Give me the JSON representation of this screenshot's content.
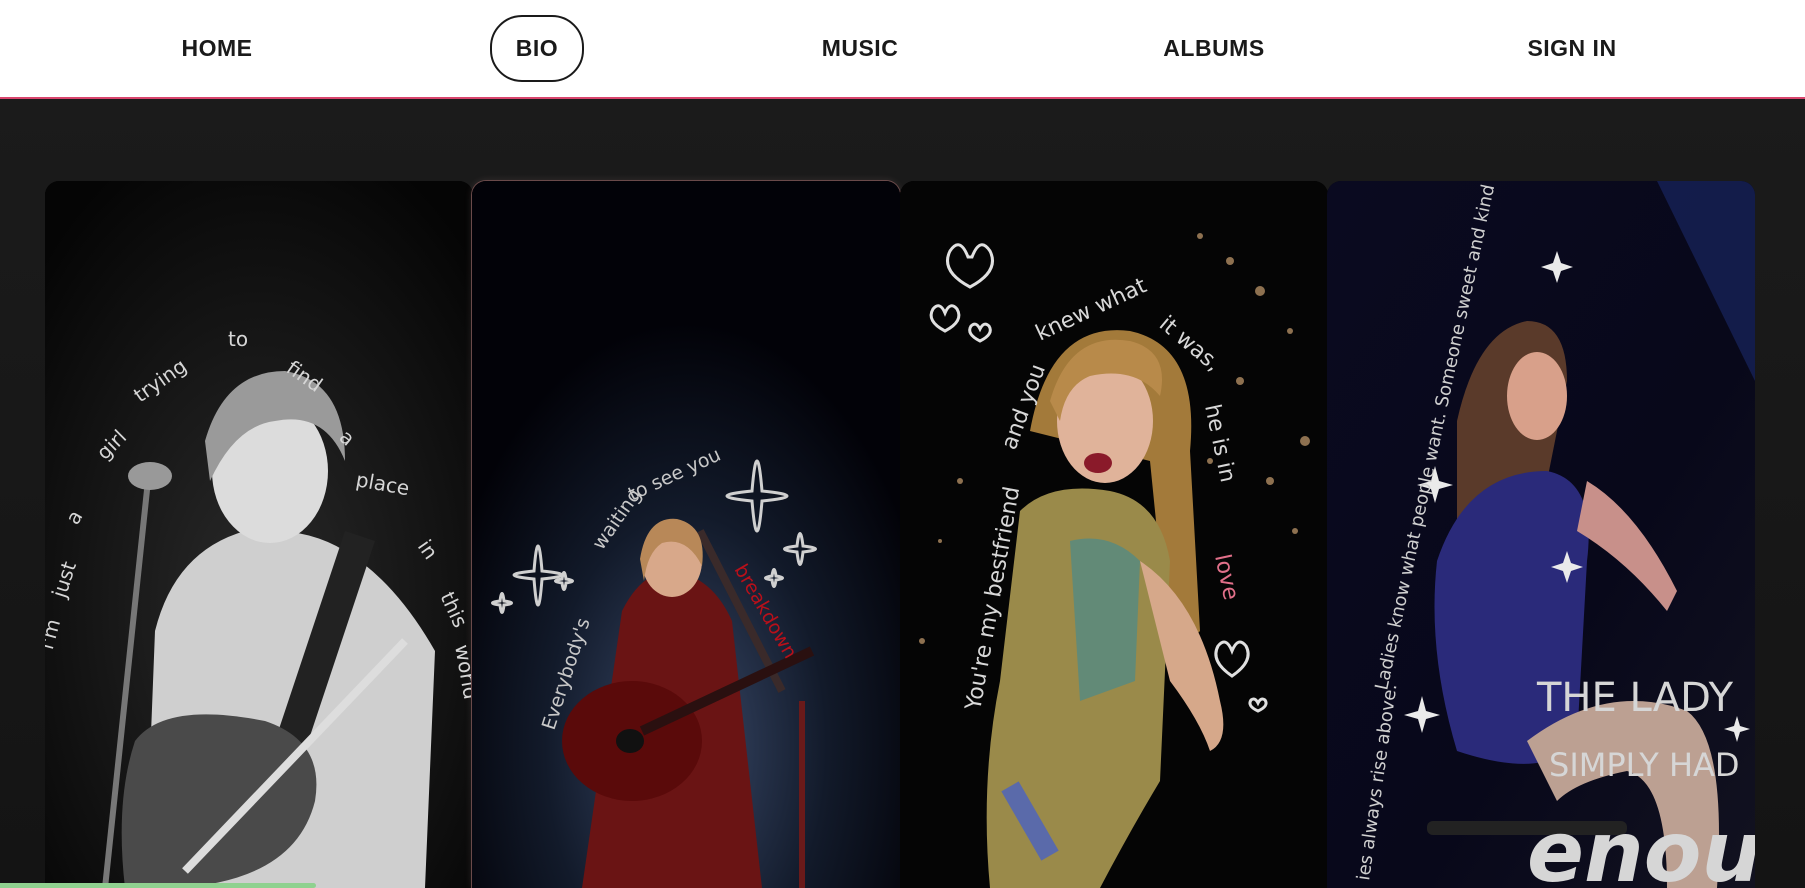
{
  "nav": {
    "items": [
      {
        "label": "HOME",
        "active": false
      },
      {
        "label": "BIO",
        "active": true
      },
      {
        "label": "MUSIC",
        "active": false
      },
      {
        "label": "ALBUMS",
        "active": false
      },
      {
        "label": "SIGN IN",
        "active": false
      }
    ]
  },
  "colors": {
    "nav_border_accent": "#d9456d",
    "background": "#171717",
    "progress": "#8fd18f"
  },
  "cards": [
    {
      "caption": "i'm just a girl trying to find a place in this world",
      "image": "performer-with-electric-guitar-bw"
    },
    {
      "caption": "Everybody's waiting to see you breakdown",
      "image": "performer-red-sequin-acoustic-guitar"
    },
    {
      "caption": "You're my bestfriend and you knew what it was, he is in love",
      "image": "performer-gold-bodysuit"
    },
    {
      "caption_arc": "Ladies know what people want. Someone sweet and kind and fun.",
      "caption_lower": "ies always rise above.",
      "caption_big_1": "THE LADY",
      "caption_big_2": "SIMPLY HAD",
      "caption_script": "enough",
      "image": "performer-sequin-leotard-chair"
    }
  ],
  "progress": {
    "fraction": 0.175
  }
}
